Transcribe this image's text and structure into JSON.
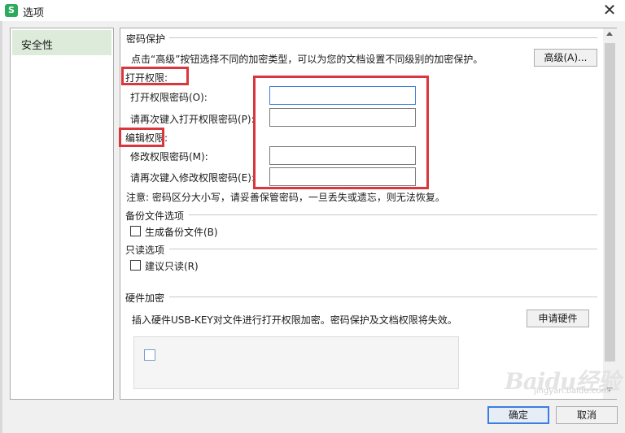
{
  "window": {
    "title": "选项",
    "app_icon_letter": "S",
    "close_glyph": "✕"
  },
  "sidebar": {
    "items": [
      {
        "label": "安全性",
        "selected": true
      }
    ]
  },
  "password_protection": {
    "section_title": "密码保护",
    "description": "点击“高级”按钮选择不同的加密类型，可以为您的文档设置不同级别的加密保护。",
    "advanced_button": "高级(A)...",
    "open_permission": {
      "heading": "打开权限:",
      "password_label": "打开权限密码(O):",
      "password_value": "",
      "confirm_label": "请再次键入打开权限密码(P):",
      "confirm_value": ""
    },
    "edit_permission": {
      "heading": "编辑权限:",
      "password_label": "修改权限密码(M):",
      "password_value": "",
      "confirm_label": "请再次键入修改权限密码(E):",
      "confirm_value": ""
    },
    "note": "注意: 密码区分大小写，请妥善保管密码，一旦丢失或遗忘，则无法恢复。"
  },
  "backup": {
    "section_title": "备份文件选项",
    "checkbox_label": "生成备份文件(B)",
    "checked": false
  },
  "readonly": {
    "section_title": "只读选项",
    "checkbox_label": "建议只读(R)",
    "checked": false
  },
  "hardware": {
    "section_title": "硬件加密",
    "description": "插入硬件USB-KEY对文件进行打开权限加密。密码保护及文档权限将失效。",
    "apply_button": "申请硬件"
  },
  "footer": {
    "ok_button": "确定",
    "cancel_button": "取消"
  },
  "watermark": {
    "text": "Baidu经验",
    "subtext": "jingyan.baidu.com"
  },
  "colors": {
    "highlight": "#d9373d",
    "selected_bg": "#ddecda",
    "primary_border": "#3b7de0"
  }
}
